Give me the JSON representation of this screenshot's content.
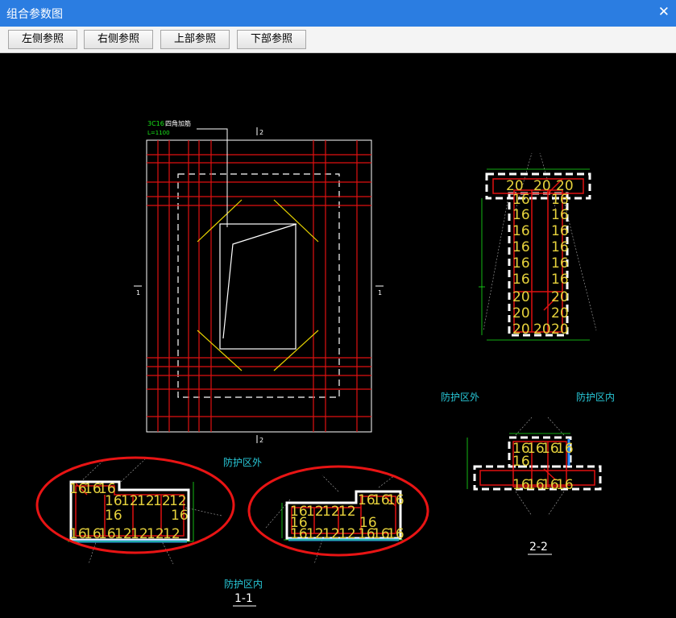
{
  "window": {
    "title": "组合参数图",
    "close_glyph": "✕"
  },
  "toolbar": {
    "buttons": [
      {
        "label": "左侧参照"
      },
      {
        "label": "右侧参照"
      },
      {
        "label": "上部参照"
      },
      {
        "label": "下部参照"
      }
    ]
  },
  "drawing": {
    "plan": {
      "note_line1": "3C16",
      "note_line1_rest": "四角加筋",
      "note_line2": "L=1100",
      "marker_top": "2",
      "marker_bottom": "2",
      "marker_left": "1",
      "marker_right": "1"
    },
    "section_1_1": {
      "label_outside": "防护区外",
      "label_inside": "防护区内",
      "caption": "1-1"
    },
    "section_2_2": {
      "label_outside": "防护区外",
      "label_inside": "防护区内",
      "caption": "2-2"
    },
    "colors": {
      "rebar": "#e01010",
      "outline": "#ffffff",
      "dimension": "#19e619",
      "label": "#28c8d8",
      "annotation_number": "#e6d23c",
      "highlight_ellipse": "#e81414",
      "chamfer_bar": "#e6d200"
    }
  }
}
